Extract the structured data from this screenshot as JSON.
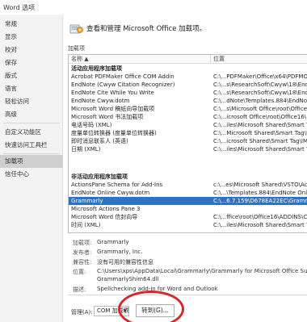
{
  "window": {
    "title": "Word 选项"
  },
  "sidebar": {
    "items": [
      {
        "label": "常规"
      },
      {
        "label": "显示"
      },
      {
        "label": "校对"
      },
      {
        "label": "保存"
      },
      {
        "label": "版式"
      },
      {
        "label": "语言"
      },
      {
        "label": "轻松访问"
      },
      {
        "label": "高级"
      },
      {
        "label": "自定义功能区"
      },
      {
        "label": "快速访问工具栏"
      },
      {
        "label": "加载项"
      },
      {
        "label": "信任中心"
      }
    ],
    "active_index": 10
  },
  "header": {
    "text": "查看和管理 Microsoft Office 加载项。"
  },
  "addins": {
    "section_label": "加载项",
    "columns": {
      "name": "名称 ▲",
      "location": "位置"
    },
    "active_group": "活动应用程序加载项",
    "active_items": [
      {
        "name": "Acrobat PDFMaker Office COM Addin",
        "location": "C:\\...PDFMaker\\Office\\x64\\PDFMO"
      },
      {
        "name": "EndNote (Cwyw Citation Recognizer)",
        "location": "C:\\...s\\ResearchSoft\\Cwyw\\18\\End"
      },
      {
        "name": "EndNote Cite While You Write",
        "location": "C:\\...s\\ResearchSoft\\Cwyw\\18\\End"
      },
      {
        "name": "EndNote Cwyw.dotm",
        "location": "C:\\...dNote\\Templates.884\\EndNot"
      },
      {
        "name": "Microsoft Word 稿纸向导加载项",
        "location": "C:\\...s\\Microsoft Office\\root\\Office"
      },
      {
        "name": "Microsoft Word 书法加载项",
        "location": "C:\\...icrosoft Office\\root\\Office16\\"
      },
      {
        "name": "电话号码 (XML)",
        "location": "C:\\...iles\\Microsoft Shared\\Smart Ta"
      },
      {
        "name": "度量单位转换器 (度量单位转换器)",
        "location": "C:\\...Microsoft Shared\\Smart Tag\\M"
      },
      {
        "name": "即时消息联系人 (英语)",
        "location": "C:\\...icrosoft Shared\\Smart Tag\\IM"
      },
      {
        "name": "日期 (XML)",
        "location": "C:\\...iles\\Microsoft Shared\\Smart Ta"
      }
    ],
    "inactive_group": "非活动应用程序加载项",
    "inactive_items": [
      {
        "name": "ActionsPane Schema for Add-Ins",
        "location": "c:\\...es\\Microsoft Shared\\VSTO\\Act"
      },
      {
        "name": "EndNote Online Cwyw.dotm",
        "location": "C:\\...\\Templates.884\\EndNote Onli"
      },
      {
        "name": "Grammarly",
        "location": "C:\\...6.7.159\\D678EA22EC\\Gramma"
      },
      {
        "name": "Microsoft Actions Pane 3",
        "location": ""
      },
      {
        "name": "Microsoft Word 信封向导",
        "location": "C:\\...ffice\\root\\Office16\\ADDINS\\C"
      },
      {
        "name": "时间 (XML)",
        "location": "C:\\...iles\\Microsoft Shared\\Smart Ta"
      }
    ],
    "selected_name": "Grammarly"
  },
  "details": {
    "addin_label": "加载项:",
    "addin_value": "Grammarly",
    "publisher_label": "发布者:",
    "publisher_value": "Grammarly, Inc.",
    "compat_label": "兼容性:",
    "compat_value": "没有可用的兼容性信息",
    "location_label": "位置:",
    "location_value_1": "C:\\Users\\xps\\AppData\\Local\\Grammarly\\Grammarly for Microsoft Office Suit",
    "location_value_2": "GrammarlyShim64.dll",
    "desc_label": "描述:",
    "desc_value": "Spellchecking add-in for Word and Outlook"
  },
  "manage": {
    "label": "管理(A):",
    "selected": "COM 加载项",
    "go_label": "转到(G)..."
  },
  "colors": {
    "selection": "#2a73c7",
    "annotation": "#d6282a",
    "sidebar_bg": "#f3f3f3",
    "sidebar_active": "#cfcfcf"
  },
  "icons": {
    "header": "addins-gear-icon",
    "dropdown": "chevron-down-icon"
  }
}
